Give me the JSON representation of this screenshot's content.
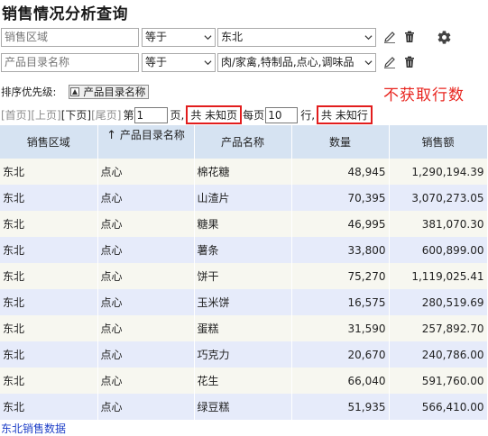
{
  "page": {
    "title": "销售情况分析查询"
  },
  "filters": [
    {
      "field_placeholder": "销售区域",
      "operator": "等于",
      "value": "东北"
    },
    {
      "field_placeholder": "产品目录名称",
      "operator": "等于",
      "value": "肉/家禽,特制品,点心,调味品"
    }
  ],
  "sort": {
    "label": "排序优先级:",
    "tag": "产品目录名称"
  },
  "notice": "不获取行数",
  "pager": {
    "first": "[首页]",
    "prev": "[上页]",
    "next": "[下页]",
    "last": "[尾页]",
    "page_prefix": "第",
    "page_value": "1",
    "page_suffix": "页,",
    "total_pages": "共 未知页",
    "per_page_prefix": "每页",
    "per_page_value": "10",
    "per_page_suffix": "行,",
    "total_rows": "共 未知行"
  },
  "table": {
    "headers": [
      "销售区域",
      "产品目录名称",
      "产品名称",
      "数量",
      "销售额"
    ],
    "sort_indicator": "↑",
    "rows": [
      [
        "东北",
        "点心",
        "棉花糖",
        "48,945",
        "1,290,194.39"
      ],
      [
        "东北",
        "点心",
        "山渣片",
        "70,395",
        "3,070,273.05"
      ],
      [
        "东北",
        "点心",
        "糖果",
        "46,995",
        "381,070.30"
      ],
      [
        "东北",
        "点心",
        "薯条",
        "33,800",
        "600,899.00"
      ],
      [
        "东北",
        "点心",
        "饼干",
        "75,270",
        "1,119,025.41"
      ],
      [
        "东北",
        "点心",
        "玉米饼",
        "16,575",
        "280,519.69"
      ],
      [
        "东北",
        "点心",
        "蛋糕",
        "31,590",
        "257,892.70"
      ],
      [
        "东北",
        "点心",
        "巧克力",
        "20,670",
        "240,786.00"
      ],
      [
        "东北",
        "点心",
        "花生",
        "66,040",
        "591,760.00"
      ],
      [
        "东北",
        "点心",
        "绿豆糕",
        "51,935",
        "566,410.00"
      ]
    ]
  },
  "footer": {
    "link": "东北销售数据"
  },
  "colors": {
    "header_bg": "#d6e3f2",
    "row_odd": "#f7f7f0",
    "row_even": "#e6ebfa",
    "alert": "#e8251f",
    "link": "#1f40c8"
  },
  "icons": [
    "edit-icon",
    "trash-icon",
    "gear-icon",
    "chevron-down-icon",
    "sort-asc-icon"
  ]
}
